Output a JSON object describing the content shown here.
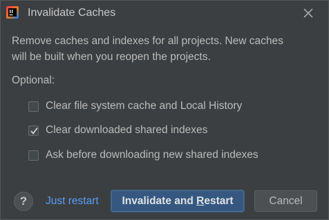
{
  "window": {
    "title": "Invalidate Caches",
    "app_icon": "intellij-idea-icon",
    "close_icon": "close-icon"
  },
  "description": {
    "line1": "Remove caches and indexes for all projects. New caches",
    "line2": "will be built when you reopen the projects."
  },
  "optional_label": "Optional:",
  "options": [
    {
      "label": "Clear file system cache and Local History",
      "checked": false
    },
    {
      "label": "Clear downloaded shared indexes",
      "checked": true
    },
    {
      "label": "Ask before downloading new shared indexes",
      "checked": false
    }
  ],
  "footer": {
    "help_label": "?",
    "just_restart_label": "Just restart",
    "primary_pre": "Invalidate and ",
    "primary_mnemonic": "R",
    "primary_post": "estart",
    "cancel_label": "Cancel"
  },
  "colors": {
    "background": "#3c3f41",
    "text": "#bbbbbb",
    "link": "#589df6",
    "primary_button": "#365880"
  }
}
